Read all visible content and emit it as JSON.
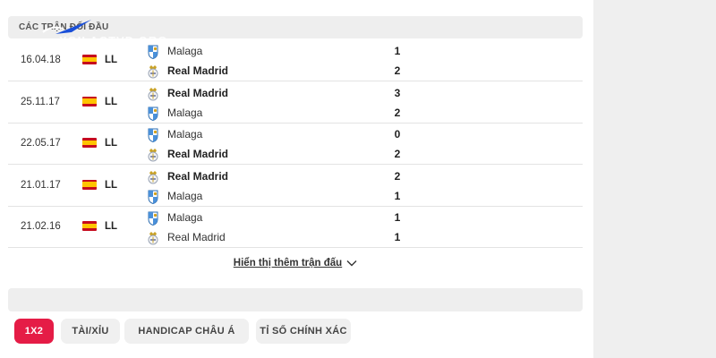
{
  "section": {
    "title": "CÁC TRẬN ĐỐI ĐẦU",
    "watermark": "XOILACTVD.ORG"
  },
  "matches": [
    {
      "date": "16.04.18",
      "competition": "LL",
      "team1": "Malaga",
      "score1": "1",
      "team1_winner": false,
      "team2": "Real Madrid",
      "score2": "2",
      "team2_winner": true
    },
    {
      "date": "25.11.17",
      "competition": "LL",
      "team1": "Real Madrid",
      "score1": "3",
      "team1_winner": true,
      "team2": "Malaga",
      "score2": "2",
      "team2_winner": false
    },
    {
      "date": "22.05.17",
      "competition": "LL",
      "team1": "Malaga",
      "score1": "0",
      "team1_winner": false,
      "team2": "Real Madrid",
      "score2": "2",
      "team2_winner": true
    },
    {
      "date": "21.01.17",
      "competition": "LL",
      "team1": "Real Madrid",
      "score1": "2",
      "team1_winner": true,
      "team2": "Malaga",
      "score2": "1",
      "team2_winner": false
    },
    {
      "date": "21.02.16",
      "competition": "LL",
      "team1": "Malaga",
      "score1": "1",
      "team1_winner": false,
      "team2": "Real Madrid",
      "score2": "1",
      "team2_winner": false
    }
  ],
  "show_more": {
    "label": "Hiển thị thêm trận đấu",
    "icon": "chevron-down-icon"
  },
  "tabs": [
    {
      "label": "1X2",
      "active": true
    },
    {
      "label": "TÀI/XỈU",
      "active": false
    },
    {
      "label": "HANDICAP CHÂU Á",
      "active": false
    },
    {
      "label": "TỈ SỐ CHÍNH XÁC",
      "active": false
    }
  ],
  "colors": {
    "accent": "#e51c46",
    "header_bg": "#eeeeee",
    "flag_red": "#c60b1e",
    "flag_yellow": "#ffc400"
  },
  "icons": {
    "flag": "spain-flag-icon",
    "crest_real_madrid": "real-madrid-crest-icon",
    "crest_malaga": "malaga-crest-icon"
  }
}
